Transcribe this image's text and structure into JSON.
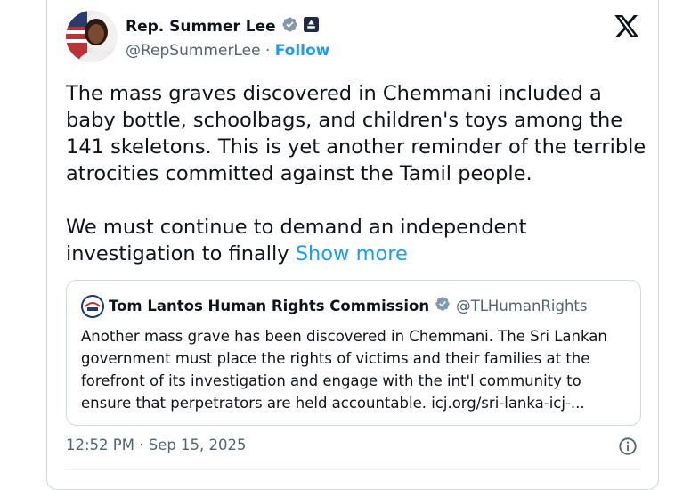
{
  "author": {
    "name": "Rep. Summer Lee",
    "handle": "@RepSummerLee",
    "separator": "·",
    "follow_label": "Follow"
  },
  "tweet": {
    "text": "The mass graves discovered in Chemmani included a baby bottle, schoolbags, and children's toys among the 141 skeletons. This is yet another reminder of the terrible atrocities committed against the Tamil people.\n\nWe must continue to demand an independent investigation to finally ",
    "show_more": "Show more"
  },
  "quoted": {
    "name": "Tom Lantos Human Rights Commission",
    "handle": "@TLHumanRights",
    "text": "Another mass grave has been discovered in Chemmani. The Sri Lankan government must place the rights of victims and their families at the forefront of its investigation and engage with the int'l community to ensure that perpetrators are held accountable. icj.org/sri-lanka-icj-..."
  },
  "timestamp": "12:52 PM · Sep 15, 2025",
  "colors": {
    "accent": "#1d9bf0",
    "verified": "#829aab",
    "muted": "#536471",
    "text": "#0f1419",
    "border": "#cfd9de"
  },
  "icons": [
    "verified-icon",
    "government-badge-icon",
    "x-logo-icon",
    "info-icon"
  ]
}
